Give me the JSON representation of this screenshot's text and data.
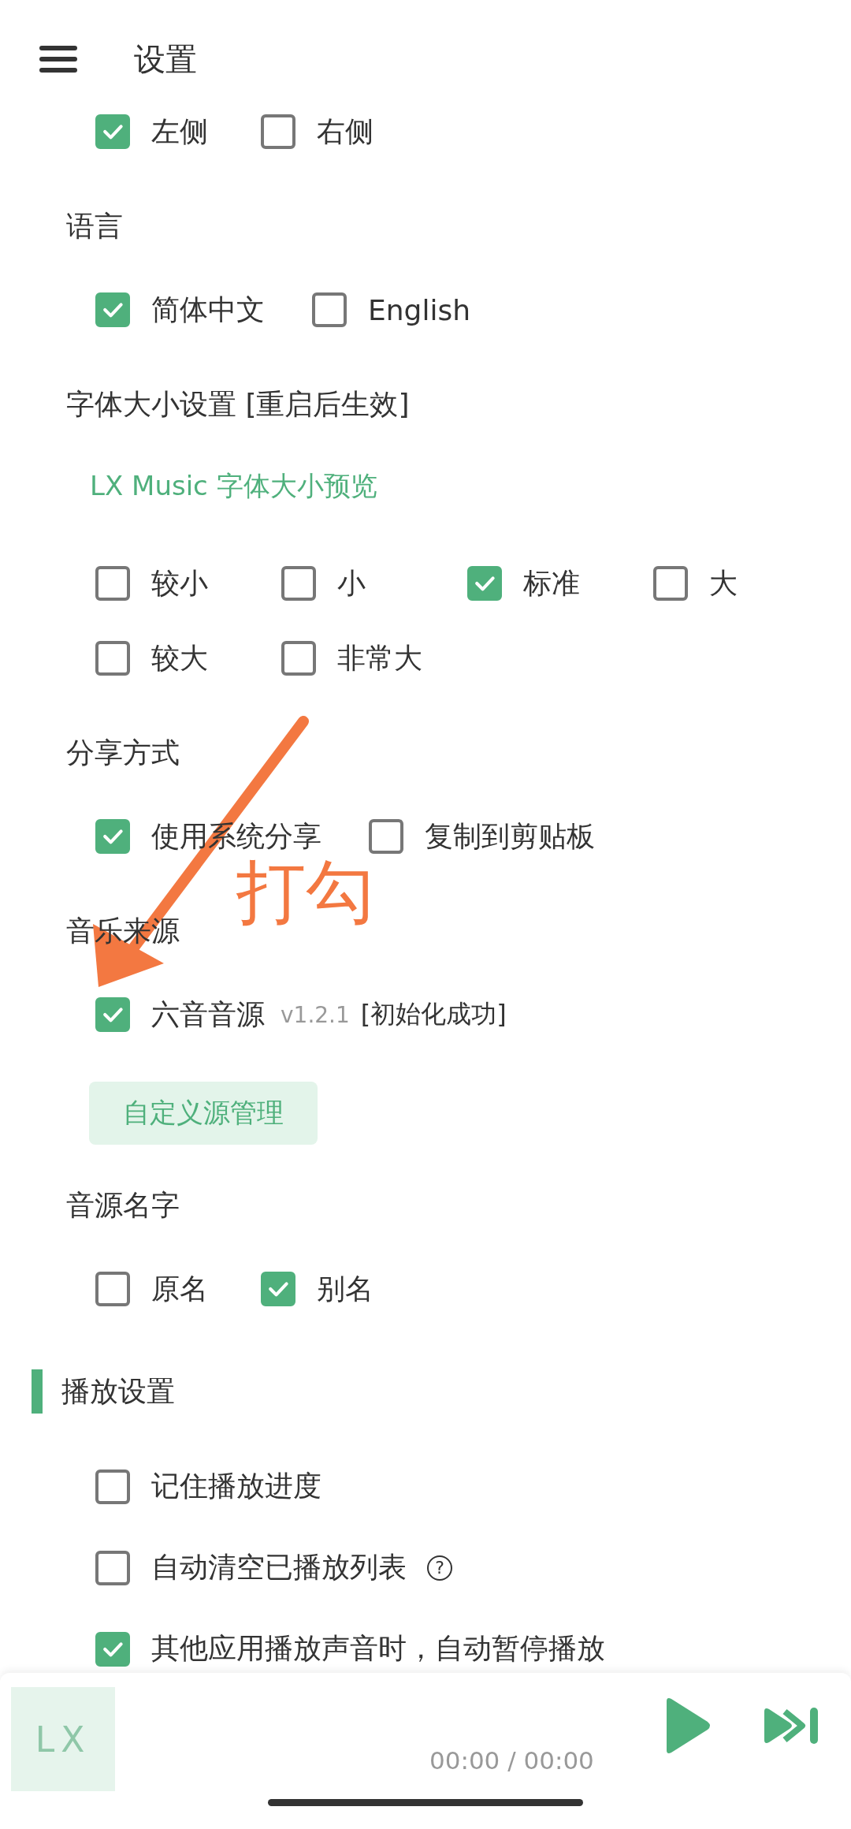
{
  "header": {
    "title": "设置"
  },
  "items": [
    {
      "kind": "options",
      "options": [
        {
          "label": "左侧",
          "checked": true
        },
        {
          "label": "右侧",
          "checked": false
        }
      ]
    },
    {
      "kind": "heading",
      "text": "语言"
    },
    {
      "kind": "options",
      "options": [
        {
          "label": "简体中文",
          "checked": true
        },
        {
          "label": "English",
          "checked": false
        }
      ]
    },
    {
      "kind": "heading",
      "text": "字体大小设置 [重启后生效]"
    },
    {
      "kind": "preview",
      "text": "LX Music 字体大小预览"
    },
    {
      "kind": "options",
      "options": [
        {
          "label": "较小",
          "checked": false
        },
        {
          "label": "小",
          "checked": false
        },
        {
          "label": "标准",
          "checked": true
        },
        {
          "label": "大",
          "checked": false
        },
        {
          "label": "较大",
          "checked": false
        },
        {
          "label": "非常大",
          "checked": false
        }
      ]
    },
    {
      "kind": "heading",
      "text": "分享方式"
    },
    {
      "kind": "options",
      "options": [
        {
          "label": "使用系统分享",
          "checked": true
        },
        {
          "label": "复制到剪贴板",
          "checked": false
        }
      ]
    },
    {
      "kind": "heading",
      "text": "音乐来源"
    },
    {
      "kind": "options",
      "options": [
        {
          "label": "六音音源",
          "version": "v1.2.1",
          "status": "[初始化成功]",
          "checked": true
        }
      ]
    },
    {
      "kind": "button",
      "text": "自定义源管理"
    },
    {
      "kind": "heading",
      "text": "音源名字"
    },
    {
      "kind": "options",
      "options": [
        {
          "label": "原名",
          "checked": false
        },
        {
          "label": "别名",
          "checked": true
        }
      ]
    },
    {
      "kind": "section",
      "text": "播放设置"
    },
    {
      "kind": "check",
      "label": "记住播放进度",
      "checked": false
    },
    {
      "kind": "check",
      "label": "自动清空已播放列表",
      "help": "?",
      "checked": false
    },
    {
      "kind": "check",
      "label": "其他应用播放声音时，自动暂停播放",
      "checked": true
    }
  ],
  "annotation": {
    "text": "打勾"
  },
  "player": {
    "cover": "LX",
    "time": "00:00 / 00:00"
  }
}
